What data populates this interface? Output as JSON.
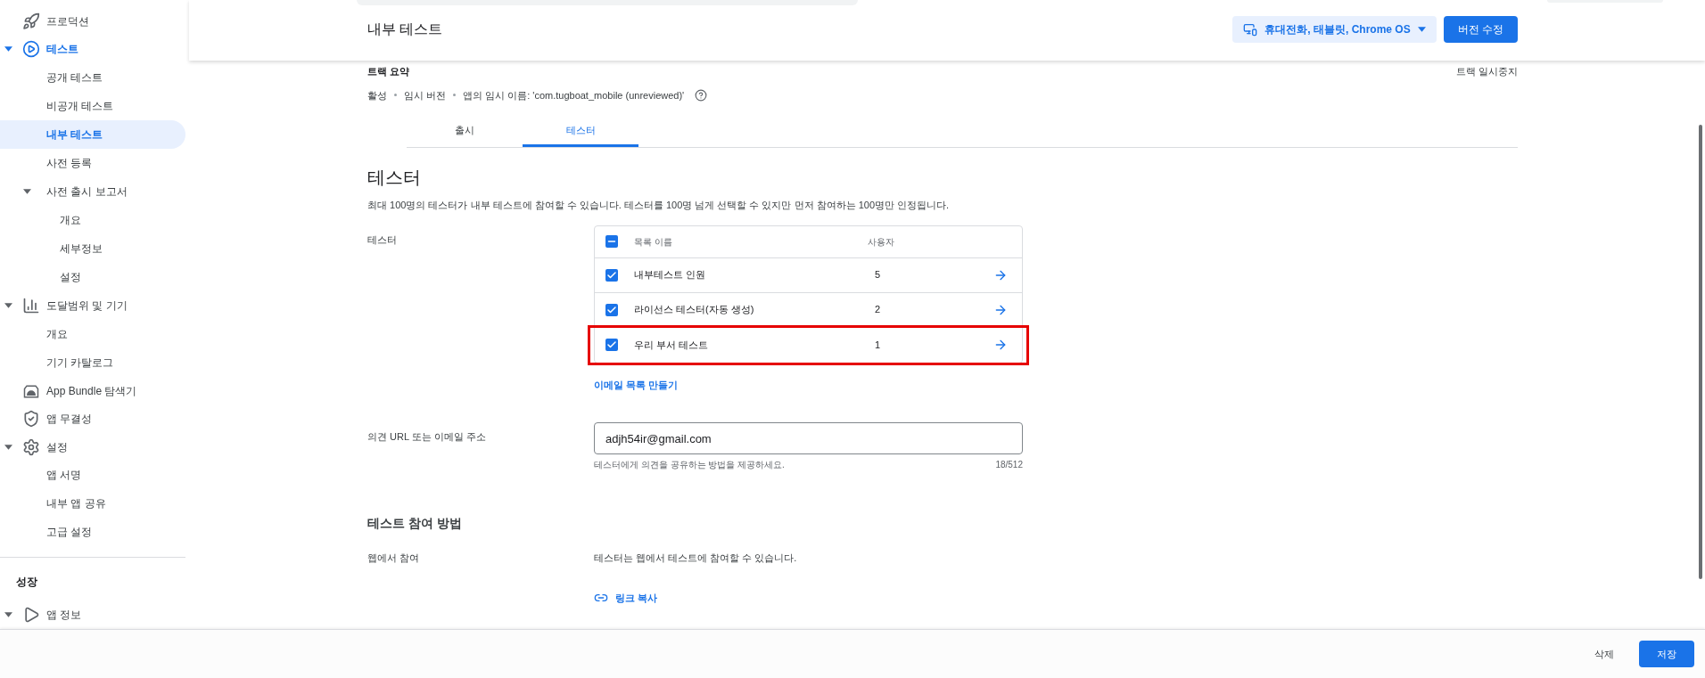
{
  "sidebar": {
    "items": [
      {
        "label": "프로덕션",
        "expanded": false,
        "active": false,
        "selected": false
      },
      {
        "label": "테스트",
        "expanded": true,
        "active": true,
        "selected": false,
        "children": [
          {
            "label": "공개 테스트",
            "selected": false
          },
          {
            "label": "비공개 테스트",
            "selected": false
          },
          {
            "label": "내부 테스트",
            "selected": true
          },
          {
            "label": "사전 등록",
            "selected": false
          },
          {
            "label": "사전 출시 보고서",
            "expanded": true,
            "selected": false,
            "children": [
              {
                "label": "개요",
                "selected": false
              },
              {
                "label": "세부정보",
                "selected": false
              },
              {
                "label": "설정",
                "selected": false
              }
            ]
          }
        ]
      },
      {
        "label": "도달범위 및 기기",
        "expanded": true,
        "active": false,
        "selected": false,
        "children": [
          {
            "label": "개요",
            "selected": false
          },
          {
            "label": "기기 카탈로그",
            "selected": false
          }
        ]
      },
      {
        "label": "App Bundle 탐색기",
        "expanded": false,
        "active": false,
        "selected": false
      },
      {
        "label": "앱 무결성",
        "expanded": false,
        "active": false,
        "selected": false
      },
      {
        "label": "설정",
        "expanded": true,
        "active": false,
        "selected": false,
        "children": [
          {
            "label": "앱 서명",
            "selected": false
          },
          {
            "label": "내부 앱 공유",
            "selected": false
          },
          {
            "label": "고급 설정",
            "selected": false
          }
        ]
      }
    ],
    "section": "성장",
    "section_items": [
      {
        "label": "앱 정보",
        "expanded": true,
        "active": false,
        "selected": false
      }
    ]
  },
  "header": {
    "title": "내부 테스트",
    "device_filter": "휴대전화, 태블릿, Chrome OS",
    "edit_button": "버전 수정"
  },
  "track_summary": {
    "title": "트랙 요약",
    "pause": "트랙 일시중지",
    "status": [
      "활성",
      "임시 버전",
      "앱의 임시 이름: 'com.tugboat_mobile (unreviewed)'"
    ]
  },
  "tabs": [
    {
      "label": "출시",
      "selected": false
    },
    {
      "label": "테스터",
      "selected": true
    }
  ],
  "testers": {
    "heading": "테스터",
    "description": "최대 100명의 테스터가 내부 테스트에 참여할 수 있습니다. 테스터를 100명 넘게 선택할 수 있지만 먼저 참여하는 100명만 인정됩니다.",
    "label": "테스터",
    "table": {
      "columns": [
        "목록 이름",
        "사용자"
      ],
      "select_all_partial": true,
      "rows": [
        {
          "name": "내부테스트 인원",
          "users": "5",
          "checked": true,
          "highlighted": false
        },
        {
          "name": "라이선스 테스터(자동 생성)",
          "users": "2",
          "checked": true,
          "highlighted": false
        },
        {
          "name": "우리 부서 테스트",
          "users": "1",
          "checked": true,
          "highlighted": true
        }
      ]
    },
    "create_link": "이메일 목록 만들기"
  },
  "feedback": {
    "label": "의견 URL 또는 이메일 주소",
    "value": "adjh54ir@gmail.com",
    "hint": "테스터에게 의견을 공유하는 방법을 제공하세요.",
    "counter": "18/512"
  },
  "join": {
    "heading": "테스트 참여 방법",
    "label": "웹에서 참여",
    "text": "테스터는 웹에서 테스트에 참여할 수 있습니다.",
    "copy_link": "링크 복사"
  },
  "footer": {
    "delete": "삭제",
    "save": "저장"
  }
}
